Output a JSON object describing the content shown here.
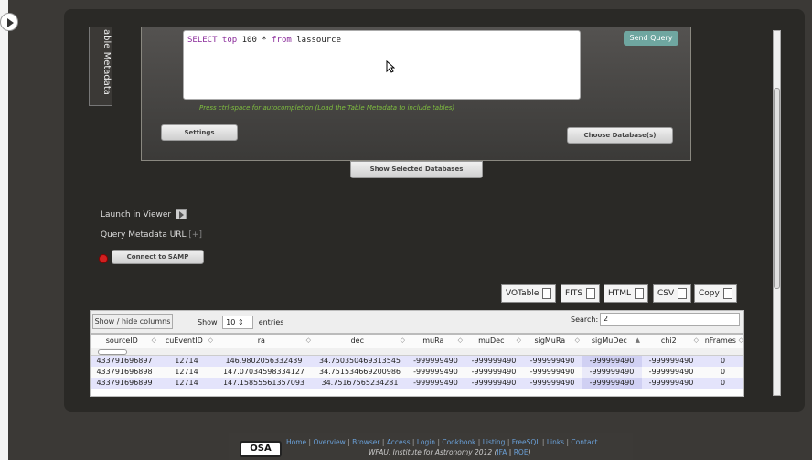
{
  "query": {
    "metadata_tab": "Table Metadata",
    "metadata_tab_visible": "able Metadata",
    "sql_keyword1": "SELECT top",
    "sql_number": "100",
    "sql_star": "*",
    "sql_keyword2": "from",
    "sql_table": "lassource",
    "send_label": "Send Query",
    "hint": "Press ctrl-space for autocompletion (Load the Table Metadata to include tables)",
    "settings_label": "Settings",
    "choose_db_label": "Choose Database(s)",
    "show_db_label": "Show Selected Databases"
  },
  "options": {
    "launch_label": "Launch in Viewer",
    "metadata_url_label": "Query Metadata URL",
    "metadata_url_plus": "[+]",
    "samp_label": "Connect to SAMP"
  },
  "export": {
    "votable": "VOTable",
    "fits": "FITS",
    "html": "HTML",
    "csv": "CSV",
    "copy": "Copy"
  },
  "table_controls": {
    "showhide_label": "Show / hide columns",
    "show_label": "Show",
    "length_value": "10",
    "entries_label": "entries",
    "search_label": "Search:",
    "search_value": "2"
  },
  "table": {
    "columns": [
      "sourceID",
      "cuEventID",
      "ra",
      "dec",
      "muRa",
      "muDec",
      "sigMuRa",
      "sigMuDec",
      "chi2",
      "nFrames"
    ],
    "rows": [
      [
        "433791696897",
        "12714",
        "146.9802056332439",
        "34.750350469313545",
        "-999999490",
        "-999999490",
        "-999999490",
        "-999999490",
        "-999999490",
        "0"
      ],
      [
        "433791696898",
        "12714",
        "147.07034598334127",
        "34.751534669200986",
        "-999999490",
        "-999999490",
        "-999999490",
        "-999999490",
        "-999999490",
        "0"
      ],
      [
        "433791696899",
        "12714",
        "147.15855561357093",
        "34.75167565234281",
        "-999999490",
        "-999999490",
        "-999999490",
        "-999999490",
        "-999999490",
        "0"
      ]
    ]
  },
  "footer": {
    "links": [
      "Home",
      "Overview",
      "Browser",
      "Access",
      "Login",
      "Cookbook",
      "Listing",
      "FreeSQL",
      "Links",
      "Contact"
    ],
    "logo": "OSA",
    "institute": "WFAU, Institute for Astronomy 2012",
    "ifa": "IFA",
    "roe": "ROE"
  },
  "colors": {
    "panel": "#2a2926",
    "accent": "#6fa6a0",
    "hint": "#7fbf3f",
    "samp_dot": "#d02020"
  },
  "icons": [
    "play-toggle-icon",
    "launch-viewer-icon",
    "file-icon",
    "copy-icon",
    "sort-icon",
    "mouse-cursor-icon"
  ]
}
